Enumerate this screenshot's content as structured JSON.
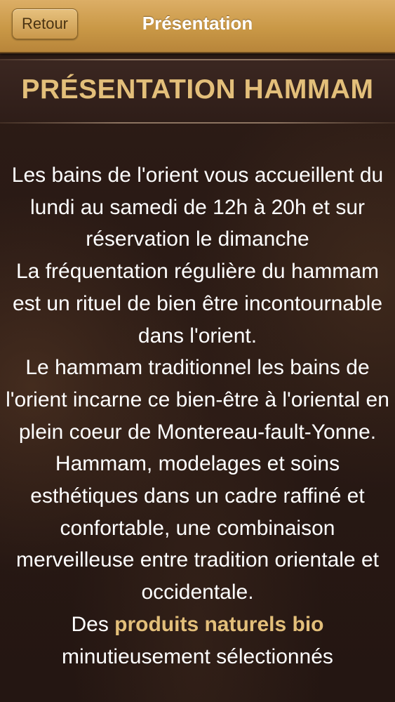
{
  "navbar": {
    "back_label": "Retour",
    "title": "Présentation"
  },
  "page": {
    "heading": "PRÉSENTATION HAMMAM"
  },
  "content": {
    "paragraphs": [
      "Les bains de l'orient vous accueillent du lundi au samedi de 12h à 20h et sur réservation le dimanche",
      "La fréquentation régulière du hammam est un rituel de bien être incontournable dans l'orient.",
      "Le hammam traditionnel les bains de l'orient incarne ce bien-être à l'oriental en plein coeur de Montereau-fault-Yonne.",
      "Hammam, modelages et soins esthétiques dans un cadre raffiné et confortable, une combinaison merveilleuse entre tradition orientale et occidentale."
    ],
    "last_paragraph": {
      "prefix": "Des ",
      "highlight": "produits naturels bio",
      "suffix": " minutieusement sélectionnés"
    }
  },
  "colors": {
    "navbar": "#c99846",
    "accent_gold": "#e3bf7a",
    "background": "#2a1a14",
    "text": "#ffffff"
  }
}
